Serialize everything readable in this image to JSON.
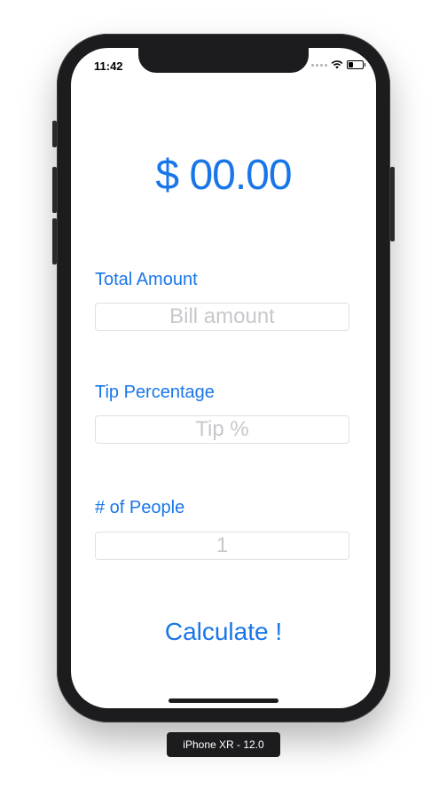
{
  "status_bar": {
    "time": "11:42"
  },
  "result": {
    "amount": "$ 00.00"
  },
  "total_amount": {
    "label": "Total Amount",
    "placeholder": "Bill amount",
    "value": ""
  },
  "tip_percentage": {
    "label": "Tip Percentage",
    "placeholder": "Tip %",
    "value": ""
  },
  "people": {
    "label": "# of People",
    "value": "",
    "placeholder": "1"
  },
  "calculate": {
    "label": "Calculate !"
  },
  "simulator": {
    "label": "iPhone XR - 12.0"
  },
  "colors": {
    "accent": "#1976e8",
    "frame": "#1c1c1e"
  }
}
